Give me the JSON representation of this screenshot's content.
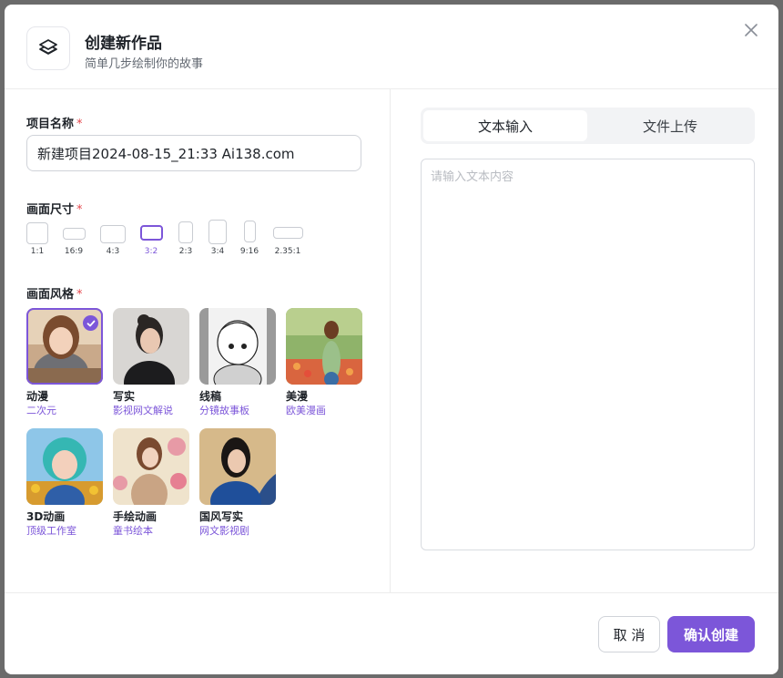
{
  "dialog": {
    "title": "创建新作品",
    "subtitle": "简单几步绘制你的故事",
    "icon": "layers-icon",
    "close_icon": "close-icon"
  },
  "form": {
    "project_name": {
      "label": "项目名称",
      "required_mark": "*",
      "value": "新建项目2024-08-15_21:33 Ai138.com"
    },
    "canvas_size": {
      "label": "画面尺寸",
      "required_mark": "*",
      "selected": "3:2",
      "options": [
        {
          "label": "1:1"
        },
        {
          "label": "16:9"
        },
        {
          "label": "4:3"
        },
        {
          "label": "3:2"
        },
        {
          "label": "2:3"
        },
        {
          "label": "3:4"
        },
        {
          "label": "9:16"
        },
        {
          "label": "2.35:1"
        }
      ]
    },
    "style": {
      "label": "画面风格",
      "required_mark": "*",
      "selected": "动漫",
      "options": [
        {
          "name": "动漫",
          "sub": "二次元"
        },
        {
          "name": "写实",
          "sub": "影视网文解说"
        },
        {
          "name": "线稿",
          "sub": "分镜故事板"
        },
        {
          "name": "美漫",
          "sub": "欧美漫画"
        },
        {
          "name": "3D动画",
          "sub": "顶级工作室"
        },
        {
          "name": "手绘动画",
          "sub": "童书绘本"
        },
        {
          "name": "国风写实",
          "sub": "网文影视剧"
        }
      ]
    }
  },
  "input_panel": {
    "tabs": [
      {
        "label": "文本输入",
        "active": true
      },
      {
        "label": "文件上传",
        "active": false
      }
    ],
    "text_placeholder": "请输入文本内容",
    "text_value": ""
  },
  "footer": {
    "cancel_label": "取 消",
    "confirm_label": "确认创建"
  },
  "colors": {
    "accent": "#7c56d9",
    "required": "#e5484d",
    "border": "#d0d3d9"
  }
}
